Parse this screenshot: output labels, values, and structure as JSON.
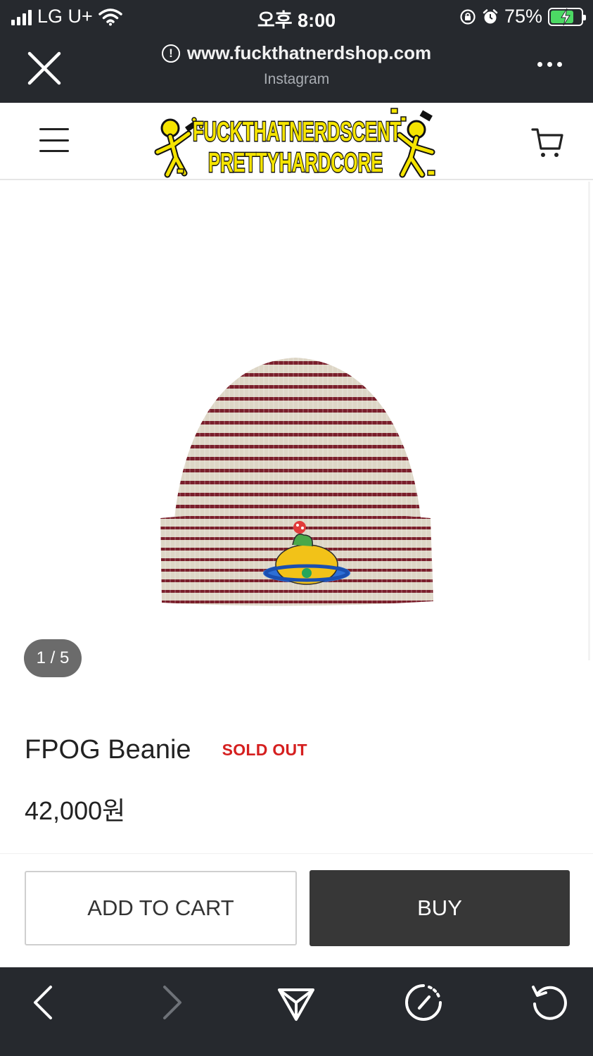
{
  "status_bar": {
    "carrier": "LG U+",
    "time": "오후 8:00",
    "battery_percent": "75%",
    "battery_level": 0.75,
    "icons": [
      "signal-icon",
      "wifi-icon",
      "rotation-lock-icon",
      "alarm-icon",
      "battery-charging-icon"
    ]
  },
  "browser": {
    "url": "www.fuckthatnerdshop.com",
    "source": "Instagram",
    "close_icon": "close-icon",
    "more_icon": "more-icon"
  },
  "site_header": {
    "logo_text_line1": "FUCKTHATNERDSCENT",
    "logo_text_line2": "PRETTYHARDCORE",
    "menu_icon": "hamburger-icon",
    "cart_icon": "cart-icon"
  },
  "gallery": {
    "counter": "1 / 5",
    "current": 1,
    "total": 5
  },
  "product": {
    "name": "FPOG Beanie",
    "status": "SOLD OUT",
    "price": "42,000원"
  },
  "actions": {
    "add_to_cart": "ADD TO CART",
    "buy": "BUY"
  },
  "toolbar": {
    "icons": [
      "back-icon",
      "forward-icon",
      "share-icon",
      "compass-icon",
      "refresh-icon"
    ]
  },
  "colors": {
    "chrome_dark": "#26292e",
    "sold_out_red": "#d51f1f",
    "buy_button": "#373737",
    "logo_yellow": "#f5e400",
    "stripe_burgundy": "#7a1f2b",
    "knit_cream": "#ddd6c6"
  }
}
